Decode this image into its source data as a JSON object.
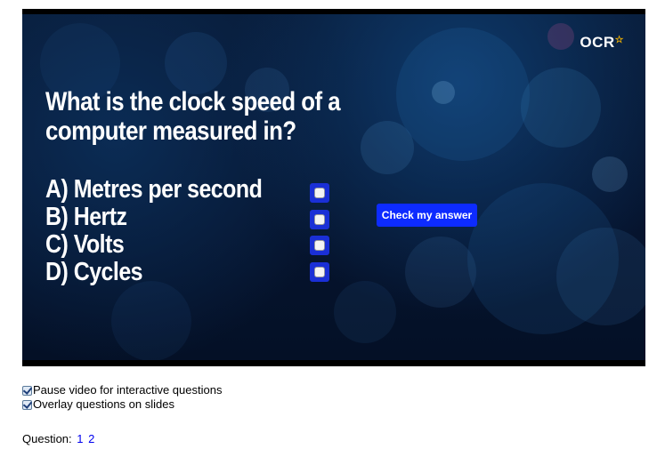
{
  "slide": {
    "logo_text": "OCR",
    "question": "What is the clock speed of a computer measured in?",
    "options": [
      {
        "label": "A) Metres per second",
        "checked": false
      },
      {
        "label": "B) Hertz",
        "checked": false
      },
      {
        "label": "C) Volts",
        "checked": false
      },
      {
        "label": "D) Cycles",
        "checked": false
      }
    ],
    "check_button": "Check my answer"
  },
  "settings": [
    {
      "label": "Pause video for interactive questions",
      "checked": true
    },
    {
      "label": "Overlay questions on slides",
      "checked": true
    }
  ],
  "question_nav": {
    "label": "Question:",
    "links": [
      "1",
      "2"
    ]
  },
  "colors": {
    "button_blue": "#0d2bff",
    "checkbox_frame": "#1a2fd6",
    "link": "#0000ee",
    "slide_bg": "#061530"
  }
}
